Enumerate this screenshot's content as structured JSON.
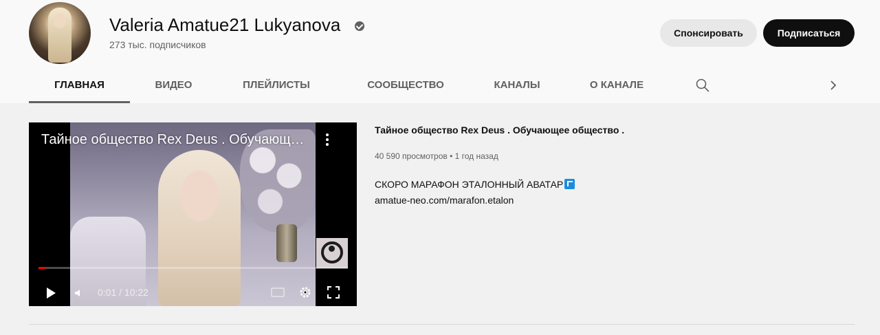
{
  "channel": {
    "name": "Valeria Amatue21 Lukyanova",
    "subscribers": "273 тыс. подписчиков",
    "sponsor_label": "Спонсировать",
    "subscribe_label": "Подписаться"
  },
  "tabs": [
    {
      "label": "ГЛАВНАЯ",
      "active": true
    },
    {
      "label": "ВИДЕО"
    },
    {
      "label": "ПЛЕЙЛИСТЫ"
    },
    {
      "label": "СООБЩЕСТВО"
    },
    {
      "label": "КАНАЛЫ"
    },
    {
      "label": "О КАНАЛЕ"
    }
  ],
  "icons": {
    "search": "search-icon",
    "next": "chevron-right-icon",
    "verified": "verified-check-icon"
  },
  "featured": {
    "player_title": "Тайное общество Rex Deus . Обучающее общество .",
    "time": "0:01 / 10:22",
    "progress_fraction": 0.0016,
    "title": "Тайное общество Rex Deus . Обучающее общество .",
    "meta": "40 590 просмотров • 1 год назад",
    "description_line1": "СКОРО МАРАФОН ЭТАЛОННЫЙ АВАТАР",
    "description_link": "amatue-neo.com/marafon.etalon"
  },
  "colors": {
    "subscribe_bg": "#0f0f0f",
    "progress": "#ff0000",
    "link_icon": "#1a8ce0"
  }
}
